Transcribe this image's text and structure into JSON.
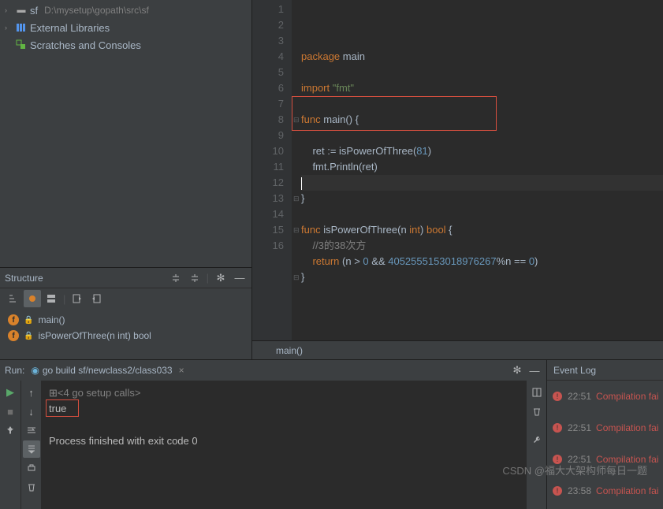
{
  "project": {
    "root": {
      "name": "sf",
      "path": "D:\\mysetup\\gopath\\src\\sf"
    },
    "ext_lib": "External Libraries",
    "scratch": "Scratches and Consoles"
  },
  "structure": {
    "title": "Structure",
    "items": [
      {
        "icon": "f",
        "name": "main()"
      },
      {
        "icon": "f",
        "name": "isPowerOfThree(n int) bool"
      }
    ]
  },
  "code": {
    "lines": [
      {
        "n": 1,
        "t": [
          {
            "c": "kw",
            "v": "package"
          },
          {
            "c": "",
            "v": " main"
          }
        ]
      },
      {
        "n": 2,
        "t": []
      },
      {
        "n": 3,
        "t": [
          {
            "c": "kw",
            "v": "import"
          },
          {
            "c": "",
            "v": " "
          },
          {
            "c": "str",
            "v": "\"fmt\""
          }
        ]
      },
      {
        "n": 4,
        "t": []
      },
      {
        "n": 5,
        "fold": "-",
        "t": [
          {
            "c": "kw",
            "v": "func"
          },
          {
            "c": "",
            "v": " "
          },
          {
            "c": "fn",
            "v": "main"
          },
          {
            "c": "",
            "v": "() {"
          }
        ]
      },
      {
        "n": 6,
        "t": []
      },
      {
        "n": 7,
        "t": [
          {
            "c": "",
            "v": "    ret := isPowerOfThree("
          },
          {
            "c": "num",
            "v": "81"
          },
          {
            "c": "",
            "v": ")"
          }
        ]
      },
      {
        "n": 8,
        "t": [
          {
            "c": "",
            "v": "    fmt.Println(ret)"
          }
        ]
      },
      {
        "n": 9,
        "caret": true,
        "t": []
      },
      {
        "n": 10,
        "fold": "-",
        "t": [
          {
            "c": "",
            "v": "}"
          }
        ]
      },
      {
        "n": 11,
        "t": []
      },
      {
        "n": 12,
        "fold": "-",
        "t": [
          {
            "c": "kw",
            "v": "func"
          },
          {
            "c": "",
            "v": " "
          },
          {
            "c": "fn",
            "v": "isPowerOfThree"
          },
          {
            "c": "",
            "v": "(n "
          },
          {
            "c": "kw",
            "v": "int"
          },
          {
            "c": "",
            "v": ") "
          },
          {
            "c": "kw",
            "v": "bool"
          },
          {
            "c": "",
            "v": " {"
          }
        ]
      },
      {
        "n": 13,
        "t": [
          {
            "c": "",
            "v": "    "
          },
          {
            "c": "cmt",
            "v": "//3的38次方"
          }
        ]
      },
      {
        "n": 14,
        "t": [
          {
            "c": "",
            "v": "    "
          },
          {
            "c": "kw",
            "v": "return"
          },
          {
            "c": "",
            "v": " (n > "
          },
          {
            "c": "num",
            "v": "0"
          },
          {
            "c": "",
            "v": " && "
          },
          {
            "c": "num",
            "v": "4052555153018976267"
          },
          {
            "c": "",
            "v": "%n == "
          },
          {
            "c": "num",
            "v": "0"
          },
          {
            "c": "",
            "v": ")"
          }
        ]
      },
      {
        "n": 15,
        "fold": "-",
        "t": [
          {
            "c": "",
            "v": "}"
          }
        ]
      },
      {
        "n": 16,
        "t": []
      }
    ],
    "breadcrumb": "main()"
  },
  "run": {
    "label": "Run:",
    "tab": "go build sf/newclass2/class033",
    "output": {
      "setup": "<4 go setup calls>",
      "result": "true",
      "exit": "Process finished with exit code 0"
    }
  },
  "eventlog": {
    "title": "Event Log",
    "items": [
      {
        "time": "22:51",
        "msg": "Compilation failed"
      },
      {
        "time": "22:51",
        "msg": "Compilation failed"
      },
      {
        "time": "22:51",
        "msg": "Compilation failed"
      },
      {
        "time": "23:58",
        "msg": "Compilation failed"
      }
    ]
  },
  "watermark": "CSDN @福大大架构师每日一题"
}
